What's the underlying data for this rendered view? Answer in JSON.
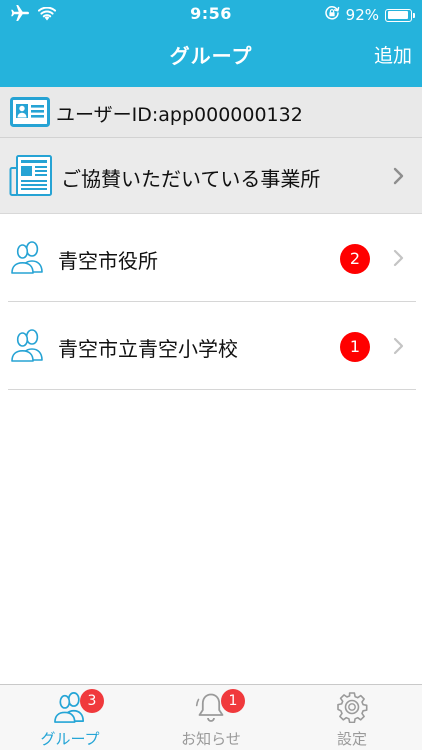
{
  "status_bar": {
    "time": "9:56",
    "battery_percent": "92%",
    "battery_level": 0.92,
    "icons": [
      "airplane-icon",
      "wifi-icon",
      "orientation-lock-icon",
      "battery-icon"
    ]
  },
  "nav": {
    "title": "グループ",
    "add_label": "追加"
  },
  "user": {
    "id_label": "ユーザーID:app000000132",
    "icon": "id-card-icon"
  },
  "sponsor": {
    "label": "ご協賛いただいている事業所",
    "icon": "newspaper-icon"
  },
  "groups": [
    {
      "name": "青空市役所",
      "badge": "2",
      "icon": "group-people-icon"
    },
    {
      "name": "青空市立青空小学校",
      "badge": "1",
      "icon": "group-people-icon"
    }
  ],
  "tabs": [
    {
      "label": "グループ",
      "badge": "3",
      "active": true,
      "icon": "group-people-icon"
    },
    {
      "label": "お知らせ",
      "badge": "1",
      "active": false,
      "icon": "bell-icon"
    },
    {
      "label": "設定",
      "badge": "",
      "active": false,
      "icon": "gear-icon"
    }
  ],
  "colors": {
    "header": "#25b3dc",
    "accent": "#25a5d6",
    "badge": "#ff0000",
    "tab_badge": "#f0393c",
    "inactive": "#9a9a9a"
  }
}
